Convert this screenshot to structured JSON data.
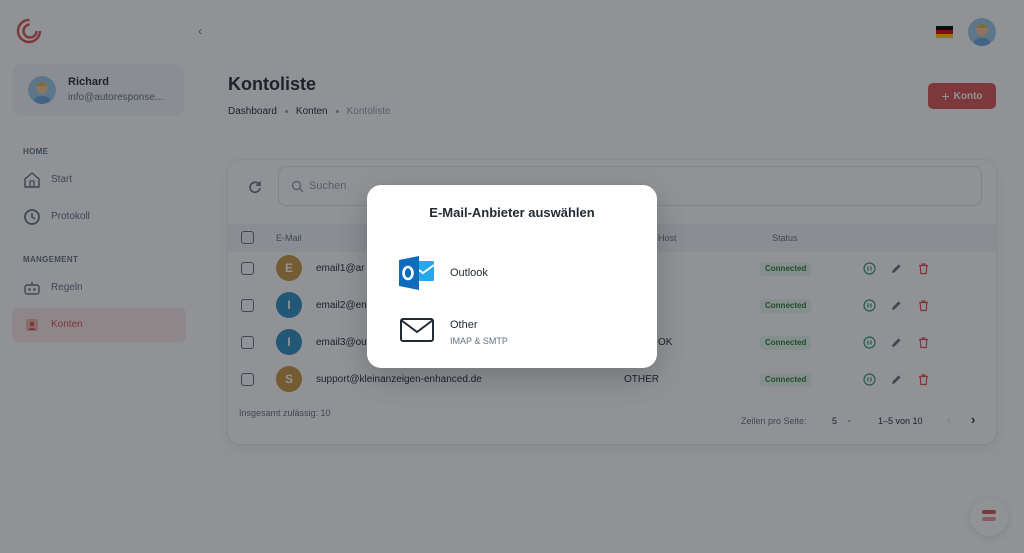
{
  "sidebar": {
    "user": {
      "name": "Richard",
      "email": "info@autoresponse..."
    },
    "sections": [
      {
        "label": "HOME",
        "items": [
          {
            "label": "Start",
            "icon": "home-icon"
          },
          {
            "label": "Protokoll",
            "icon": "clock-icon"
          }
        ]
      },
      {
        "label": "MANGEMENT",
        "items": [
          {
            "label": "Regeln",
            "icon": "robot-icon"
          },
          {
            "label": "Konten",
            "icon": "user-square-icon",
            "active": true
          }
        ]
      }
    ]
  },
  "header": {
    "title": "Kontoliste",
    "add_button": "Konto",
    "flag": "de"
  },
  "breadcrumb": [
    "Dashboard",
    "Konten",
    "Kontoliste"
  ],
  "search": {
    "placeholder": "Suchen"
  },
  "table": {
    "columns": [
      "E-Mail",
      "Host",
      "Status"
    ],
    "rows": [
      {
        "initial": "E",
        "email": "email1@ar",
        "host": "",
        "status": "Connected",
        "avatar_color": "#c9963e"
      },
      {
        "initial": "I",
        "email": "email2@en",
        "host": "",
        "status": "Connected",
        "avatar_color": "#2f8fc1"
      },
      {
        "initial": "I",
        "email": "email3@ou",
        "host": "OK",
        "status": "Connected",
        "avatar_color": "#2f8fc1"
      },
      {
        "initial": "S",
        "email": "support@kleinanzeigen-enhanced.de",
        "host": "OTHER",
        "status": "Connected",
        "avatar_color": "#c9963e"
      }
    ],
    "footer": {
      "total": "Insgesamt zulässig: 10",
      "rows_per_page_label": "Zeilen pro Seite:",
      "rows_per_page": "5",
      "range": "1–5 von 10"
    }
  },
  "modal": {
    "title": "E-Mail-Anbieter auswählen",
    "providers": [
      {
        "label": "Outlook",
        "sub": "",
        "icon": "outlook-icon"
      },
      {
        "label": "Other",
        "sub": "IMAP & SMTP",
        "icon": "envelope-icon"
      }
    ]
  },
  "colors": {
    "accent": "#d9534f",
    "status_bg": "#e6f7ee",
    "status_fg": "#2e7d32",
    "outlook_blue": "#0f6cbd"
  }
}
